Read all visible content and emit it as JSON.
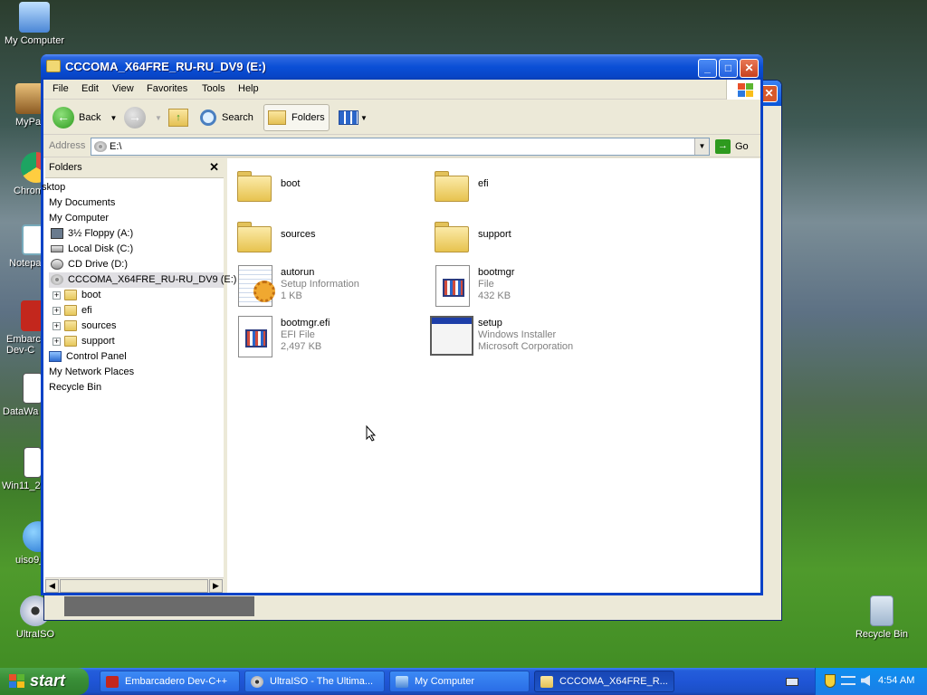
{
  "desktop": {
    "icons": [
      {
        "label": "My Computer"
      },
      {
        "label": "MyPa"
      },
      {
        "label": "Chrom"
      },
      {
        "label": "Notepa"
      },
      {
        "label": "Embarca Dev-C"
      },
      {
        "label": "DataWa"
      },
      {
        "label": "Win11_2"
      },
      {
        "label": "uiso9_"
      },
      {
        "label": "UltraISO"
      },
      {
        "label": "Recycle Bin"
      }
    ]
  },
  "window": {
    "title": "CCCOMA_X64FRE_RU-RU_DV9 (E:)",
    "minimize": "_",
    "maximize": "□",
    "close": "✕",
    "menu": [
      "File",
      "Edit",
      "View",
      "Favorites",
      "Tools",
      "Help"
    ],
    "toolbar": {
      "back": "Back",
      "search": "Search",
      "folders": "Folders"
    },
    "address": {
      "label": "Address",
      "value": "E:\\",
      "go": "Go"
    },
    "folders_pane": {
      "title": "Folders",
      "close": "✕",
      "items": [
        {
          "label": "sktop"
        },
        {
          "label": "My Documents"
        },
        {
          "label": "My Computer"
        },
        {
          "label": "3½ Floppy (A:)"
        },
        {
          "label": "Local Disk (C:)"
        },
        {
          "label": "CD Drive (D:)"
        },
        {
          "label": "CCCOMA_X64FRE_RU-RU_DV9 (E:)"
        },
        {
          "label": "boot"
        },
        {
          "label": "efi"
        },
        {
          "label": "sources"
        },
        {
          "label": "support"
        },
        {
          "label": "Control Panel"
        },
        {
          "label": "My Network Places"
        },
        {
          "label": "Recycle Bin"
        }
      ]
    },
    "files": [
      {
        "name": "boot"
      },
      {
        "name": "efi"
      },
      {
        "name": "sources"
      },
      {
        "name": "support"
      },
      {
        "name": "autorun",
        "type": "Setup Information",
        "size": "1 KB"
      },
      {
        "name": "bootmgr",
        "type": "File",
        "size": "432 KB"
      },
      {
        "name": "bootmgr.efi",
        "type": "EFI File",
        "size": "2,497 KB"
      },
      {
        "name": "setup",
        "type": "Windows Installer",
        "company": "Microsoft Corporation"
      }
    ]
  },
  "taskbar": {
    "start": "start",
    "tasks": [
      {
        "label": "Embarcadero Dev-C++"
      },
      {
        "label": "UltraISO - The Ultima..."
      },
      {
        "label": "My Computer"
      },
      {
        "label": "CCCOMA_X64FRE_R..."
      }
    ],
    "clock": "4:54 AM"
  },
  "colors": {
    "titlebar": "#0a4fd6",
    "taskbar": "#245edb",
    "start": "#3a8f38",
    "selection": "#e0dfe3"
  }
}
